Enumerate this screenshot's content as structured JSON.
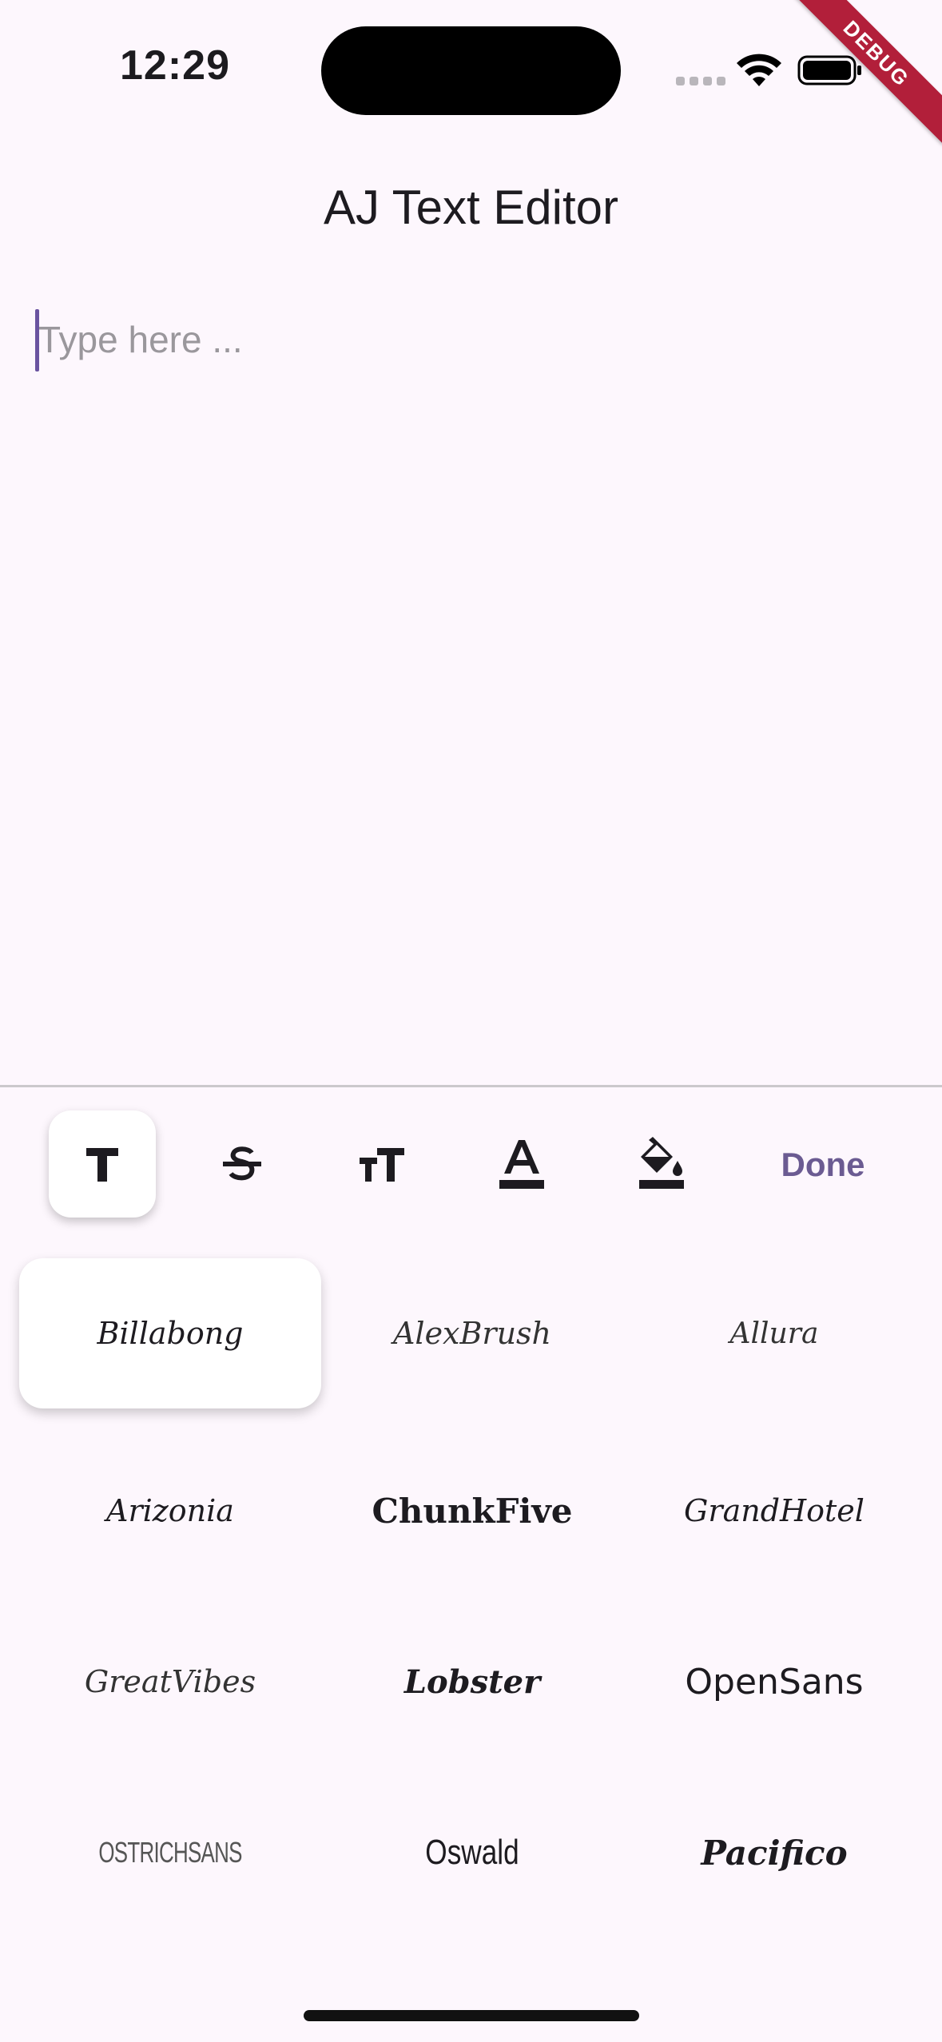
{
  "status_bar": {
    "time": "12:29",
    "debug_label": "DEBUG"
  },
  "app": {
    "title": "AJ Text Editor"
  },
  "editor": {
    "placeholder": "Type here ...",
    "value": ""
  },
  "toolbar": {
    "tools": [
      {
        "id": "font-family",
        "icon": "font-family-icon",
        "active": true
      },
      {
        "id": "strikethrough",
        "icon": "strikethrough-icon",
        "active": false
      },
      {
        "id": "font-size",
        "icon": "font-size-icon",
        "active": false
      },
      {
        "id": "text-color",
        "icon": "text-color-icon",
        "active": false
      },
      {
        "id": "background-color",
        "icon": "fill-bucket-icon",
        "active": false
      }
    ],
    "done_label": "Done"
  },
  "fonts": {
    "selected": "Billabong",
    "items": [
      {
        "label": "Billabong"
      },
      {
        "label": "AlexBrush"
      },
      {
        "label": "Allura"
      },
      {
        "label": "Arizonia"
      },
      {
        "label": "ChunkFive"
      },
      {
        "label": "GrandHotel"
      },
      {
        "label": "GreatVibes"
      },
      {
        "label": "Lobster"
      },
      {
        "label": "OpenSans"
      },
      {
        "label": "OSTRICHSANS"
      },
      {
        "label": "Oswald"
      },
      {
        "label": "Pacifico"
      }
    ]
  },
  "colors": {
    "background": "#fdf7fd",
    "accent": "#6b5b92",
    "caret": "#6a53a0",
    "debug_ribbon": "#b21f3a"
  }
}
